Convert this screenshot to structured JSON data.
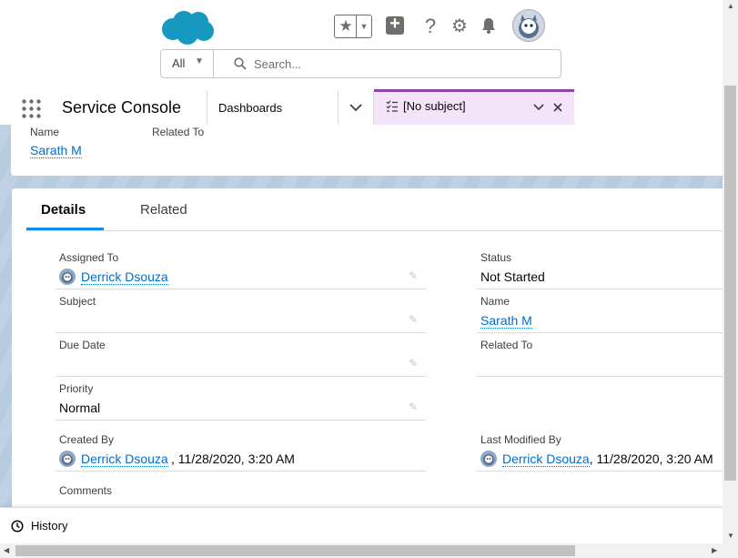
{
  "header": {
    "search_scope": "All",
    "search_placeholder": "Search..."
  },
  "nav": {
    "app_name": "Service Console",
    "dashboards_label": "Dashboards",
    "active_tab_label": "[No subject]"
  },
  "top_card": {
    "name_label": "Name",
    "related_to_label": "Related To",
    "name_value": "Sarath M"
  },
  "detail_tabs": {
    "details": "Details",
    "related": "Related"
  },
  "fields": {
    "assigned_to_label": "Assigned To",
    "assigned_to_value": "Derrick Dsouza",
    "status_label": "Status",
    "status_value": "Not Started",
    "subject_label": "Subject",
    "name_label": "Name",
    "name_value": "Sarath M",
    "due_date_label": "Due Date",
    "related_to_label": "Related To",
    "priority_label": "Priority",
    "priority_value": "Normal",
    "created_by_label": "Created By",
    "created_by_user": "Derrick Dsouza",
    "created_by_date": ", 11/28/2020, 3:20 AM",
    "last_modified_label": "Last Modified By",
    "last_modified_user": "Derrick Dsouza",
    "last_modified_date": ", 11/28/2020, 3:20 AM",
    "comments_label": "Comments"
  },
  "utility_bar": {
    "history_label": "History"
  },
  "colors": {
    "brand_cloud": "#1798c1",
    "link": "#006dcc",
    "tab_accent": "#8e44ad",
    "tab_active_bg": "#f3e4fa"
  }
}
